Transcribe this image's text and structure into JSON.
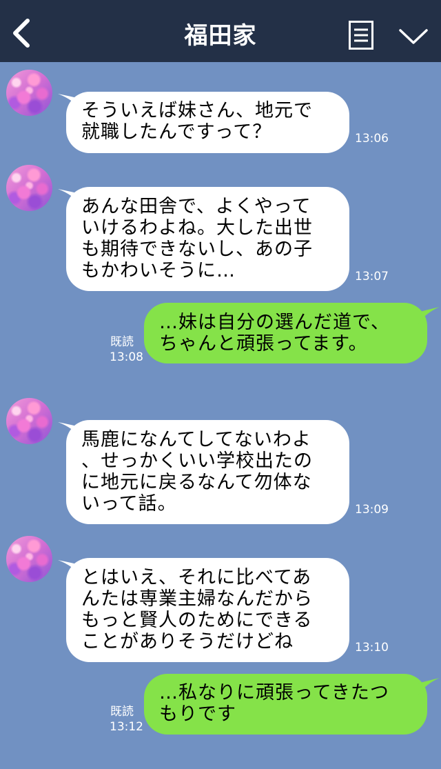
{
  "header": {
    "title": "福田家"
  },
  "messages": [
    {
      "side": "in",
      "text": "そういえば妹さん、地元で\n就職したんですって？",
      "time": "13:06"
    },
    {
      "side": "in",
      "text": "あんな田舎で、よくやって\nいけるわよね。大した出世\nも期待できないし、あの子\nもかわいそうに…",
      "time": "13:07"
    },
    {
      "side": "out",
      "text": "…妹は自分の選んだ道で、\nちゃんと頑張ってます。",
      "read": "既読",
      "time": "13:08"
    },
    {
      "side": "in",
      "text": "馬鹿になんてしてないわよ\n、せっかくいい学校出たの\nに地元に戻るなんて勿体な\nいって話。",
      "time": "13:09"
    },
    {
      "side": "in",
      "text": "とはいえ、それに比べてあ\nんたは専業主婦なんだから\nもっと賢人のためにできる\nことがありそうだけどね",
      "time": "13:10"
    },
    {
      "side": "out",
      "text": "…私なりに頑張ってきたつ\nもりです",
      "read": "既読",
      "time": "13:12"
    }
  ],
  "colors": {
    "background": "#7191c2",
    "header": "#233047",
    "out_bubble": "#85e249",
    "in_bubble": "#ffffff"
  }
}
